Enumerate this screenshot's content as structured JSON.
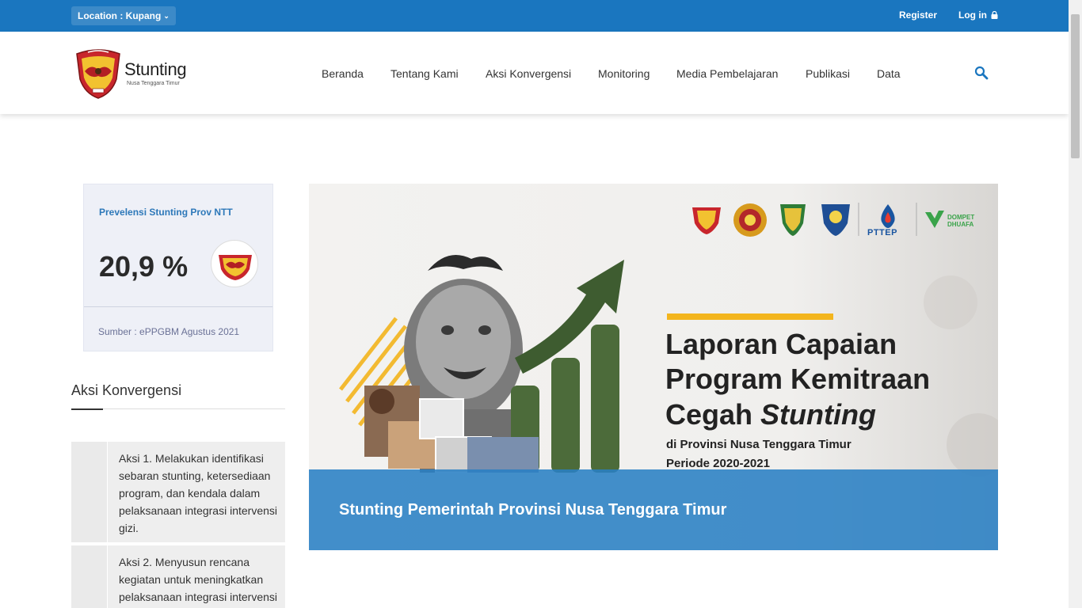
{
  "topbar": {
    "location_label": "Location : Kupang",
    "register": "Register",
    "login": "Log in"
  },
  "header": {
    "logo_title": "Stunting",
    "logo_subtitle": "Nusa Tenggara Timur",
    "nav": [
      "Beranda",
      "Tentang Kami",
      "Aksi Konvergensi",
      "Monitoring",
      "Media Pembelajaran",
      "Publikasi",
      "Data"
    ]
  },
  "prevalence": {
    "title": "Prevelensi Stunting Prov NTT",
    "value": "20,9 %",
    "source": "Sumber : ePPGBM Agustus 2021"
  },
  "aksi": {
    "title": "Aksi Konvergensi",
    "items": [
      "Aksi 1. Melakukan identifikasi sebaran stunting, ketersediaan program, dan kendala dalam pelaksanaan integrasi intervensi gizi.",
      "Aksi 2. Menyusun rencana kegiatan untuk meningkatkan pelaksanaan integrasi intervensi"
    ]
  },
  "banner": {
    "title_line1": "Laporan Capaian",
    "title_line2": "Program Kemitraan",
    "title_line3_a": "Cegah ",
    "title_line3_b": "Stunting",
    "subtitle1": "di Provinsi Nusa Tenggara Timur",
    "subtitle2": "Periode 2020-2021",
    "partner_pttep": "PTTEP",
    "partner_dompet_1": "DOMPET",
    "partner_dompet_2": "DHUAFA",
    "caption": "Stunting Pemerintah Provinsi Nusa Tenggara Timur"
  },
  "colors": {
    "topbar": "#1a76bf",
    "caption_bg": "#2980c4",
    "accent_blue": "#2d78b9",
    "card_bg": "#eef0f7",
    "banner_yellow": "#f3b51d"
  }
}
